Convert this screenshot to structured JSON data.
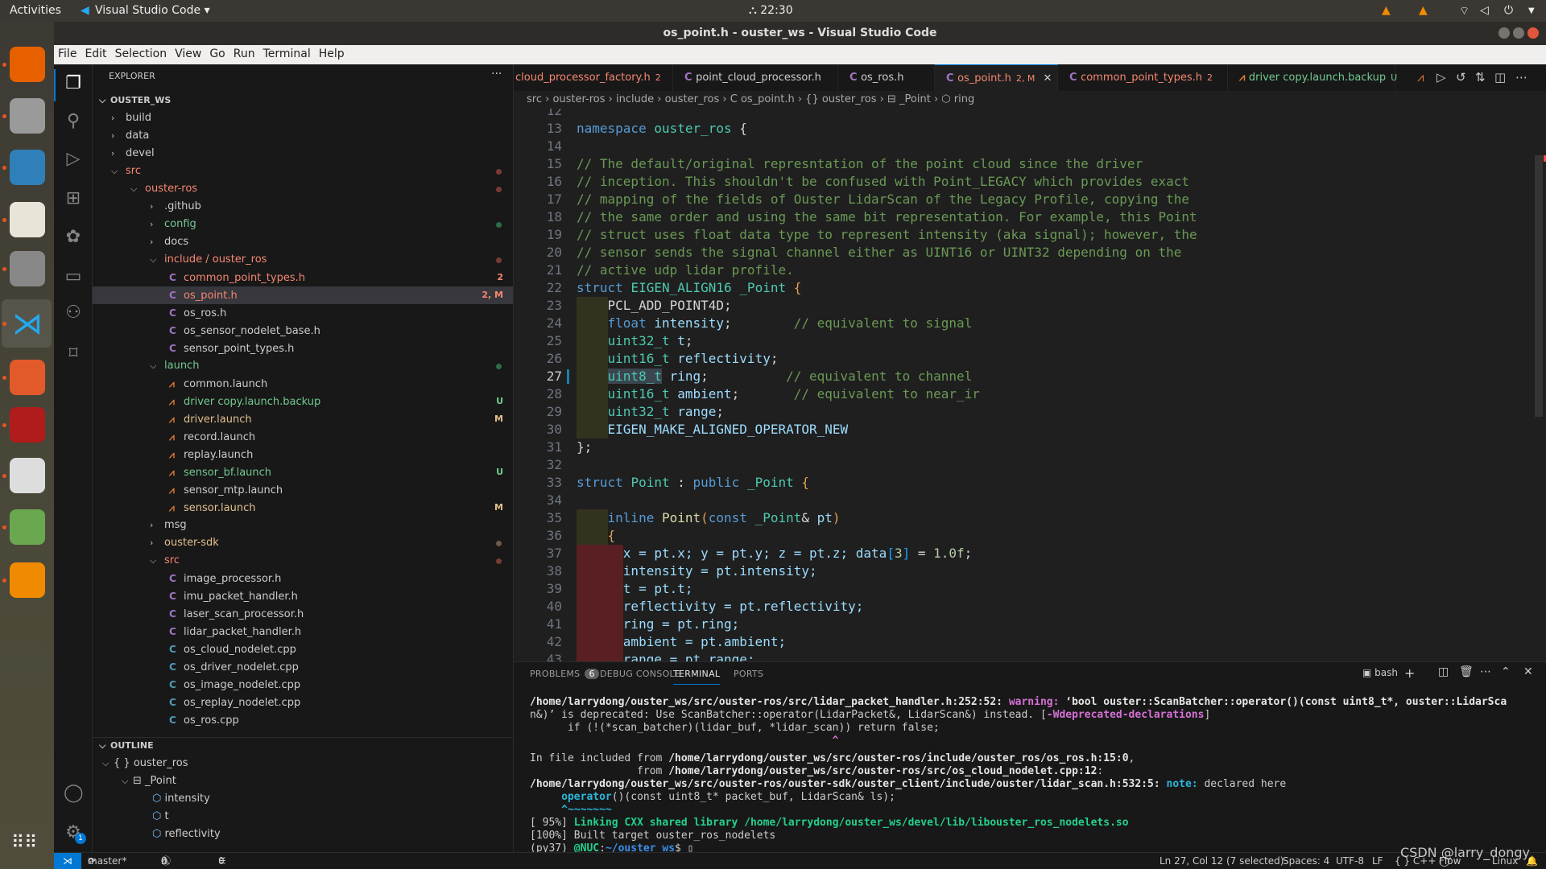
{
  "topbar": {
    "activities": "Activities",
    "app_name": "Visual Studio Code ▾",
    "clock": "⛬ 22:30",
    "tray": [
      "wifi-icon",
      "volume-icon",
      "power-icon"
    ]
  },
  "window": {
    "title": "os_point.h - ouster_ws - Visual Studio Code"
  },
  "menu": [
    "File",
    "Edit",
    "Selection",
    "View",
    "Go",
    "Run",
    "Terminal",
    "Help"
  ],
  "dock": [
    {
      "name": "firefox",
      "color": "#e66000"
    },
    {
      "name": "files-cabinet",
      "color": "#9a9a9a"
    },
    {
      "name": "shutter",
      "color": "#2f7fb8"
    },
    {
      "name": "text-editor",
      "color": "#e8e4d8"
    },
    {
      "name": "system-settings",
      "color": "#888"
    },
    {
      "name": "vscode",
      "color": "#23a9f2"
    },
    {
      "name": "file-manager",
      "color": "#e25a2a"
    },
    {
      "name": "terminal-app",
      "color": "#b01c1c"
    },
    {
      "name": "rviz",
      "color": "#ddd"
    },
    {
      "name": "image-viewer",
      "color": "#6aa84f"
    },
    {
      "name": "vlc",
      "color": "#f08a00"
    }
  ],
  "sidebar": {
    "title": "EXPLORER",
    "more": "···",
    "root": "OUSTER_WS",
    "items": [
      {
        "label": "build",
        "depth": 1,
        "kind": "folder",
        "open": false,
        "status": "normal"
      },
      {
        "label": "data",
        "depth": 1,
        "kind": "folder",
        "open": false,
        "status": "normal"
      },
      {
        "label": "devel",
        "depth": 1,
        "kind": "folder",
        "open": false,
        "status": "normal"
      },
      {
        "label": "src",
        "depth": 1,
        "kind": "folder",
        "open": true,
        "status": "error",
        "dot": "error"
      },
      {
        "label": "ouster-ros",
        "depth": 2,
        "kind": "folder",
        "open": true,
        "status": "error",
        "dot": "error"
      },
      {
        "label": ".github",
        "depth": 3,
        "kind": "folder",
        "open": false,
        "status": "normal"
      },
      {
        "label": "config",
        "depth": 3,
        "kind": "folder",
        "open": false,
        "status": "untracked",
        "dot": "untracked"
      },
      {
        "label": "docs",
        "depth": 3,
        "kind": "folder",
        "open": false,
        "status": "normal"
      },
      {
        "label": "include / ouster_ros",
        "depth": 3,
        "kind": "folder",
        "open": true,
        "status": "error",
        "dot": "error"
      },
      {
        "label": "common_point_types.h",
        "depth": 4,
        "kind": "c",
        "status": "error",
        "badge": "2"
      },
      {
        "label": "os_point.h",
        "depth": 4,
        "kind": "c",
        "status": "error",
        "badge": "2, M",
        "selected": true
      },
      {
        "label": "os_ros.h",
        "depth": 4,
        "kind": "c",
        "status": "normal"
      },
      {
        "label": "os_sensor_nodelet_base.h",
        "depth": 4,
        "kind": "c",
        "status": "normal"
      },
      {
        "label": "sensor_point_types.h",
        "depth": 4,
        "kind": "c",
        "status": "normal"
      },
      {
        "label": "launch",
        "depth": 3,
        "kind": "folder",
        "open": true,
        "status": "untracked",
        "dot": "untracked"
      },
      {
        "label": "common.launch",
        "depth": 4,
        "kind": "launch",
        "status": "normal"
      },
      {
        "label": "driver copy.launch.backup",
        "depth": 4,
        "kind": "launch",
        "status": "untracked",
        "badge": "U"
      },
      {
        "label": "driver.launch",
        "depth": 4,
        "kind": "launch",
        "status": "modified",
        "badge": "M"
      },
      {
        "label": "record.launch",
        "depth": 4,
        "kind": "launch",
        "status": "normal"
      },
      {
        "label": "replay.launch",
        "depth": 4,
        "kind": "launch",
        "status": "normal"
      },
      {
        "label": "sensor_bf.launch",
        "depth": 4,
        "kind": "launch",
        "status": "untracked",
        "badge": "U"
      },
      {
        "label": "sensor_mtp.launch",
        "depth": 4,
        "kind": "launch",
        "status": "normal"
      },
      {
        "label": "sensor.launch",
        "depth": 4,
        "kind": "launch",
        "status": "modified",
        "badge": "M"
      },
      {
        "label": "msg",
        "depth": 3,
        "kind": "folder",
        "open": false,
        "status": "normal"
      },
      {
        "label": "ouster-sdk",
        "depth": 3,
        "kind": "folder",
        "open": false,
        "status": "modified",
        "dot": "muted"
      },
      {
        "label": "src",
        "depth": 3,
        "kind": "folder",
        "open": true,
        "status": "error",
        "dot": "error"
      },
      {
        "label": "image_processor.h",
        "depth": 4,
        "kind": "c",
        "status": "normal"
      },
      {
        "label": "imu_packet_handler.h",
        "depth": 4,
        "kind": "c",
        "status": "normal"
      },
      {
        "label": "laser_scan_processor.h",
        "depth": 4,
        "kind": "c",
        "status": "normal"
      },
      {
        "label": "lidar_packet_handler.h",
        "depth": 4,
        "kind": "c",
        "status": "normal"
      },
      {
        "label": "os_cloud_nodelet.cpp",
        "depth": 4,
        "kind": "cpp",
        "status": "normal"
      },
      {
        "label": "os_driver_nodelet.cpp",
        "depth": 4,
        "kind": "cpp",
        "status": "normal"
      },
      {
        "label": "os_image_nodelet.cpp",
        "depth": 4,
        "kind": "cpp",
        "status": "normal"
      },
      {
        "label": "os_replay_nodelet.cpp",
        "depth": 4,
        "kind": "cpp",
        "status": "normal"
      },
      {
        "label": "os_ros.cpp",
        "depth": 4,
        "kind": "cpp",
        "status": "normal"
      }
    ]
  },
  "outline": {
    "title": "OUTLINE",
    "items": [
      {
        "label": "ouster_ros",
        "depth": 1,
        "icon": "{ }",
        "open": true
      },
      {
        "label": "_Point",
        "depth": 2,
        "icon": "⊟",
        "open": true
      },
      {
        "label": "intensity",
        "depth": 3,
        "icon": "⬡"
      },
      {
        "label": "t",
        "depth": 3,
        "icon": "⬡"
      },
      {
        "label": "reflectivity",
        "depth": 3,
        "icon": "⬡"
      }
    ]
  },
  "tabs": [
    {
      "label": "cloud_processor_factory.h",
      "badge": "2",
      "status": "error",
      "icon": ""
    },
    {
      "label": "point_cloud_processor.h",
      "badge": "",
      "status": "normal",
      "icon": "C"
    },
    {
      "label": "os_ros.h",
      "badge": "",
      "status": "normal",
      "icon": "C"
    },
    {
      "label": "os_point.h",
      "badge": "2, M",
      "status": "error",
      "icon": "C",
      "active": true
    },
    {
      "label": "common_point_types.h",
      "badge": "2",
      "status": "error",
      "icon": "C"
    },
    {
      "label": "driver copy.launch.backup",
      "badge": "U",
      "status": "untracked",
      "icon": "⩘"
    }
  ],
  "breadcrumb": [
    "src",
    "ouster-ros",
    "include",
    "ouster_ros",
    "C os_point.h",
    "{} ouster_ros",
    "⊟ _Point",
    "⬡ ring"
  ],
  "editor": {
    "current_line": 27,
    "lines": [
      {
        "n": 12,
        "t": []
      },
      {
        "n": 13,
        "t": [
          [
            "namespace ",
            "kw"
          ],
          [
            "ouster_ros",
            "ty"
          ],
          [
            " {",
            "pu"
          ]
        ]
      },
      {
        "n": 14,
        "t": []
      },
      {
        "n": 15,
        "t": [
          [
            "// The default/original represntation of the point cloud since the driver",
            "cm"
          ]
        ]
      },
      {
        "n": 16,
        "t": [
          [
            "// inception. This shouldn't be confused with Point_LEGACY which provides exact",
            "cm"
          ]
        ]
      },
      {
        "n": 17,
        "t": [
          [
            "// mapping of the fields of Ouster LidarScan of the Legacy Profile, copying the",
            "cm"
          ]
        ]
      },
      {
        "n": 18,
        "t": [
          [
            "// the same order and using the same bit representation. For example, this Point",
            "cm"
          ]
        ]
      },
      {
        "n": 19,
        "t": [
          [
            "// struct uses float data type to represent intensity (aka signal); however, the",
            "cm"
          ]
        ]
      },
      {
        "n": 20,
        "t": [
          [
            "// sensor sends the signal channel either as UINT16 or UINT32 depending on the",
            "cm"
          ]
        ]
      },
      {
        "n": 21,
        "t": [
          [
            "// active udp lidar profile.",
            "cm"
          ]
        ]
      },
      {
        "n": 22,
        "t": [
          [
            "struct ",
            "kw"
          ],
          [
            "EIGEN_ALIGN16 ",
            "ty"
          ],
          [
            "_Point ",
            "ty"
          ],
          [
            "{",
            "br"
          ]
        ]
      },
      {
        "n": 23,
        "ind": "olive",
        "t": [
          [
            "    PCL_ADD_POINT4D;",
            "mc"
          ]
        ]
      },
      {
        "n": 24,
        "ind": "olive",
        "t": [
          [
            "    ",
            "pu"
          ],
          [
            "float ",
            "kw"
          ],
          [
            "intensity",
            "va"
          ],
          [
            ";        ",
            "pu"
          ],
          [
            "// equivalent to signal",
            "cm"
          ]
        ]
      },
      {
        "n": 25,
        "ind": "olive",
        "t": [
          [
            "    ",
            "pu"
          ],
          [
            "uint32_t ",
            "ty"
          ],
          [
            "t",
            "va"
          ],
          [
            ";",
            "pu"
          ]
        ]
      },
      {
        "n": 26,
        "ind": "olive",
        "t": [
          [
            "    ",
            "pu"
          ],
          [
            "uint16_t ",
            "ty"
          ],
          [
            "reflectivity",
            "va"
          ],
          [
            ";",
            "pu"
          ]
        ]
      },
      {
        "n": 27,
        "ind": "olive",
        "t": [
          [
            "    ",
            "pu"
          ],
          [
            "uint8_t",
            "ty hl"
          ],
          [
            " ",
            "pu"
          ],
          [
            "ring",
            "va"
          ],
          [
            ";          ",
            "pu"
          ],
          [
            "// equivalent to channel",
            "cm"
          ]
        ]
      },
      {
        "n": 28,
        "ind": "olive",
        "t": [
          [
            "    ",
            "pu"
          ],
          [
            "uint16_t ",
            "ty"
          ],
          [
            "ambient",
            "va"
          ],
          [
            ";       ",
            "pu"
          ],
          [
            "// equivalent to near_ir",
            "cm"
          ]
        ]
      },
      {
        "n": 29,
        "ind": "olive",
        "t": [
          [
            "    ",
            "pu"
          ],
          [
            "uint32_t ",
            "ty"
          ],
          [
            "range",
            "va"
          ],
          [
            ";",
            "pu"
          ]
        ]
      },
      {
        "n": 30,
        "ind": "olive",
        "t": [
          [
            "    EIGEN_MAKE_ALIGNED_OPERATOR_NEW",
            "mb"
          ]
        ]
      },
      {
        "n": 31,
        "t": [
          [
            "};",
            "pu"
          ]
        ]
      },
      {
        "n": 32,
        "t": []
      },
      {
        "n": 33,
        "t": [
          [
            "struct ",
            "kw"
          ],
          [
            "Point ",
            "ty"
          ],
          [
            ": ",
            "pu"
          ],
          [
            "public ",
            "kw"
          ],
          [
            "_Point ",
            "ty"
          ],
          [
            "{",
            "br"
          ]
        ]
      },
      {
        "n": 34,
        "t": []
      },
      {
        "n": 35,
        "ind": "olive",
        "t": [
          [
            "    ",
            "pu"
          ],
          [
            "inline ",
            "kw"
          ],
          [
            "Point",
            "fn"
          ],
          [
            "(",
            "br"
          ],
          [
            "const ",
            "kw"
          ],
          [
            "_Point",
            "ty"
          ],
          [
            "& ",
            "pu"
          ],
          [
            "pt",
            "va"
          ],
          [
            ")",
            "br"
          ]
        ]
      },
      {
        "n": 36,
        "ind": "olive",
        "t": [
          [
            "    ",
            "pu"
          ],
          [
            "{",
            "br"
          ]
        ]
      },
      {
        "n": 37,
        "ind": "red",
        "t": [
          [
            "      x = pt.x; y = pt.y; z = pt.z; data",
            "va"
          ],
          [
            "[",
            "bb"
          ],
          [
            "3",
            "nu"
          ],
          [
            "]",
            "bb"
          ],
          [
            " = ",
            "pu"
          ],
          [
            "1.0f",
            "nu"
          ],
          [
            ";",
            "pu"
          ]
        ]
      },
      {
        "n": 38,
        "ind": "red",
        "t": [
          [
            "      intensity = pt.intensity;",
            "va"
          ]
        ]
      },
      {
        "n": 39,
        "ind": "red",
        "t": [
          [
            "      t = pt.t;",
            "va"
          ]
        ]
      },
      {
        "n": 40,
        "ind": "red",
        "t": [
          [
            "      reflectivity = pt.reflectivity;",
            "va"
          ]
        ]
      },
      {
        "n": 41,
        "ind": "red",
        "t": [
          [
            "      ring = pt.ring;",
            "va"
          ]
        ]
      },
      {
        "n": 42,
        "ind": "red",
        "t": [
          [
            "      ambient = pt.ambient;",
            "va"
          ]
        ]
      },
      {
        "n": 43,
        "ind": "red",
        "t": [
          [
            "      range = pt.range;",
            "va"
          ]
        ]
      }
    ]
  },
  "panel": {
    "tabs": [
      {
        "label": "PROBLEMS",
        "count": "6"
      },
      {
        "label": "DEBUG CONSOLE"
      },
      {
        "label": "TERMINAL",
        "active": true
      },
      {
        "label": "PORTS"
      }
    ],
    "shell": "bash",
    "terminal": [
      [
        [
          "/home/larrydong/ouster_ws/src/ouster-ros/src/lidar_packet_handler.h:252:52: ",
          "tb"
        ],
        [
          "warning: ",
          "tw"
        ],
        [
          "‘bool ouster::ScanBatcher::operator()(const uint8_t*, ouster::LidarSca",
          "tb"
        ]
      ],
      [
        [
          "n&)’ is deprecated: Use ScanBatcher::operator(LidarPacket&, LidarScan&) instead. [",
          ""
        ],
        [
          "-Wdeprecated-declarations",
          "tw"
        ],
        [
          "]",
          ""
        ]
      ],
      [
        [
          "      if (!(*scan_batcher)(lidar_buf, *lidar_scan)) return false;",
          ""
        ]
      ],
      [
        [
          "                                                ^",
          "tw"
        ]
      ],
      [
        [
          "In file included from ",
          ""
        ],
        [
          "/home/larrydong/ouster_ws/src/ouster-ros/include/ouster_ros/os_ros.h:15:0",
          "tb"
        ],
        [
          ",",
          ""
        ]
      ],
      [
        [
          "                 from ",
          ""
        ],
        [
          "/home/larrydong/ouster_ws/src/ouster-ros/src/os_cloud_nodelet.cpp:12",
          "tb"
        ],
        [
          ":",
          ""
        ]
      ],
      [
        [
          "/home/larrydong/ouster_ws/src/ouster-ros/ouster-sdk/ouster_client/include/ouster/lidar_scan.h:532:5: ",
          "tb"
        ],
        [
          "note: ",
          "tn"
        ],
        [
          "declared here",
          ""
        ]
      ],
      [
        [
          "     ",
          ""
        ],
        [
          "operator",
          "tn"
        ],
        [
          "()(const uint8_t* packet_buf, LidarScan& ls);",
          ""
        ]
      ],
      [
        [
          "     ^~~~~~~~",
          "tn"
        ]
      ],
      [
        [
          "[ 95%] ",
          ""
        ],
        [
          "Linking CXX shared library /home/larrydong/ouster_ws/devel/lib/libouster_ros_nodelets.so",
          "tgb"
        ]
      ],
      [
        [
          "[100%] Built target ouster_ros_nodelets",
          ""
        ]
      ],
      [
        [
          "(py37) ",
          ""
        ],
        [
          "@NUC",
          "tgb"
        ],
        [
          ":",
          ""
        ],
        [
          "~/ouster_ws",
          "tbl"
        ],
        [
          "$ ▯",
          ""
        ]
      ]
    ]
  },
  "status": {
    "branch": "master*",
    "errors": "6",
    "warnings": "0",
    "ports": "0",
    "position": "Ln 27, Col 12 (7 selected)",
    "spaces": "Spaces: 4",
    "encoding": "UTF-8",
    "eol": "LF",
    "language": "{ } C++",
    "flow": "Flow",
    "platform": "Linux"
  },
  "watermark": "CSDN @larry_dongy",
  "colors": {
    "accent": "#0078d4",
    "error": "#f48771",
    "untracked": "#73c991",
    "modified": "#e2c08d"
  }
}
